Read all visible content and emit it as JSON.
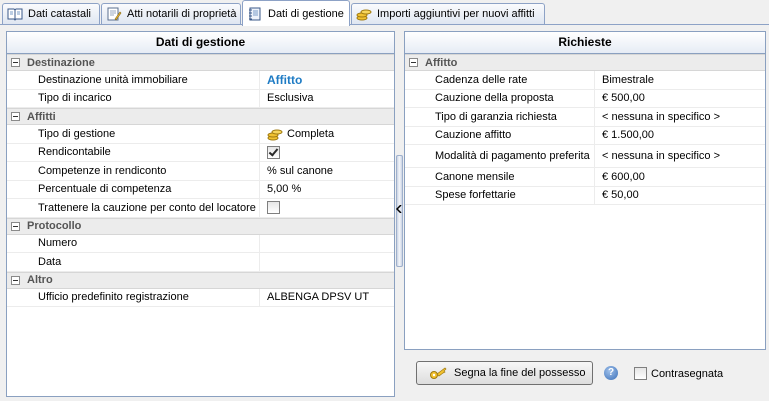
{
  "tabs": [
    {
      "label": "Dati catastali",
      "icon": "book-icon",
      "active": false
    },
    {
      "label": "Atti notarili di proprietà",
      "icon": "document-pen-icon",
      "active": false
    },
    {
      "label": "Dati di gestione",
      "icon": "notebook-icon",
      "active": true
    },
    {
      "label": "Importi aggiuntivi per nuovi affitti",
      "icon": "coins-icon",
      "active": false
    }
  ],
  "left_panel": {
    "title": "Dati di gestione",
    "groups": {
      "destinazione": {
        "title": "Destinazione",
        "rows": [
          {
            "label": "Destinazione unità immobiliare",
            "value": "Affitto"
          },
          {
            "label": "Tipo di incarico",
            "value": "Esclusiva"
          }
        ]
      },
      "affitti": {
        "title": "Affitti",
        "rows": [
          {
            "label": "Tipo di gestione",
            "value": "Completa"
          },
          {
            "label": "Rendicontabile",
            "checked": true
          },
          {
            "label": "Competenze in rendiconto",
            "value": "% sul canone"
          },
          {
            "label": "Percentuale di competenza",
            "value": "5,00 %"
          },
          {
            "label": "Trattenere la cauzione per conto del locatore",
            "checked": false
          }
        ]
      },
      "protocollo": {
        "title": "Protocollo",
        "rows": [
          {
            "label": "Numero",
            "value": ""
          },
          {
            "label": "Data",
            "value": ""
          }
        ]
      },
      "altro": {
        "title": "Altro",
        "rows": [
          {
            "label": "Ufficio predefinito registrazione",
            "value": "ALBENGA DPSV UT"
          }
        ]
      }
    }
  },
  "right_panel": {
    "title": "Richieste",
    "group_title": "Affitto",
    "rows": [
      {
        "label": "Cadenza delle rate",
        "value": "Bimestrale"
      },
      {
        "label": "Cauzione della proposta",
        "value": "€ 500,00"
      },
      {
        "label": "Tipo di garanzia richiesta",
        "value": "< nessuna in specifico >"
      },
      {
        "label": "Cauzione affitto",
        "value": "€ 1.500,00"
      },
      {
        "label": "Modalità di pagamento preferita",
        "value": "< nessuna in specifico >"
      },
      {
        "label": "Canone mensile",
        "value": "€ 600,00"
      },
      {
        "label": "Spese forfettarie",
        "value": "€ 50,00"
      }
    ]
  },
  "footer": {
    "button_label": "Segna la fine del possesso",
    "help_symbol": "?",
    "checkbox_label": "Contrasegnata",
    "checkbox_checked": false
  },
  "colors": {
    "link": "#1e7bc4",
    "border": "#8aa0c0",
    "group_bg": "#ececec"
  }
}
